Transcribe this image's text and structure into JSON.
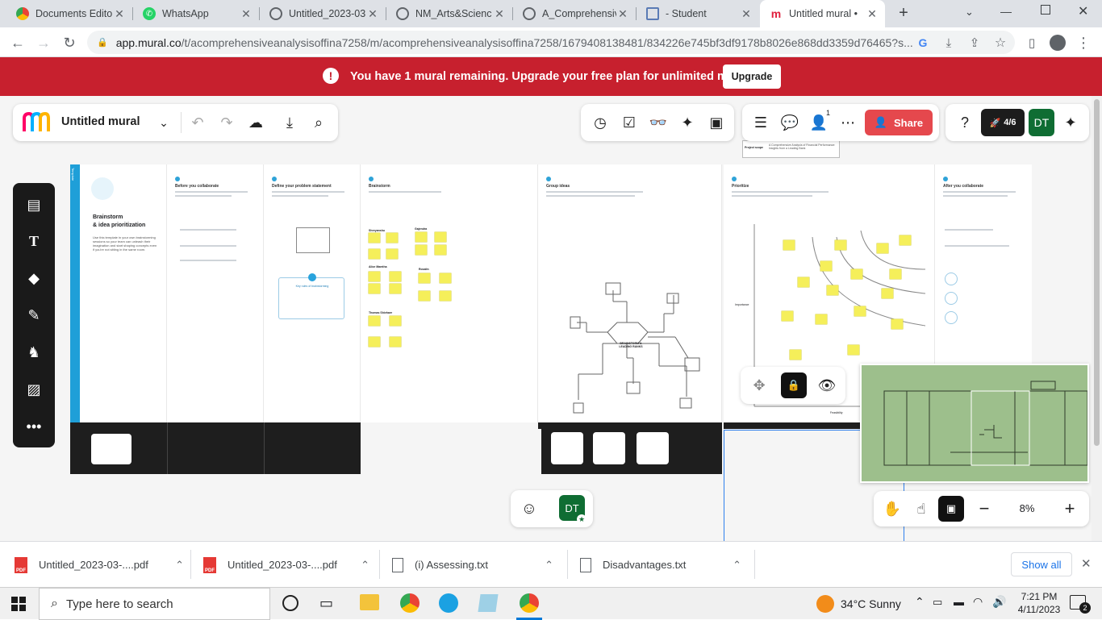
{
  "browser": {
    "tabs": [
      {
        "title": "Documents Edito",
        "favicon": "chrome-icon"
      },
      {
        "title": "WhatsApp",
        "favicon": "whatsapp-icon"
      },
      {
        "title": "Untitled_2023-03",
        "favicon": "globe-icon"
      },
      {
        "title": "NM_Arts&Scienc",
        "favicon": "globe-icon"
      },
      {
        "title": "A_Comprehensiv",
        "favicon": "globe-icon"
      },
      {
        "title": "- Student",
        "favicon": "image-icon"
      },
      {
        "title": "Untitled mural • ",
        "favicon": "mural-icon",
        "active": true
      }
    ],
    "url_host": "app.mural.co",
    "url_path": "/t/acomprehensiveanalysisoffina7258/m/acomprehensiveanalysisoffina7258/1679408138481/834226e745bf3df9178b8026e868dd3359d76465?s..."
  },
  "banner": {
    "message": "You have 1 mural remaining. Upgrade your free plan for unlimited murals.",
    "button": "Upgrade"
  },
  "mural": {
    "title": "Untitled mural",
    "share_label": "Share",
    "progress_label": "4/6",
    "progress_fraction": 0.667,
    "avatar_initials": "DT",
    "collaborator_count": "1",
    "zoom": "8%"
  },
  "board": {
    "template_tag": "Template",
    "main_title_1": "Brainstorm",
    "main_title_2": "& idea prioritization",
    "intro_text": "Use this template in your own brainstorming sessions so your team can unleash their imagination and start shaping concepts even if you're not sitting in the same room.",
    "columns": [
      {
        "title": "Before you collaborate"
      },
      {
        "title": "Define your problem statement"
      },
      {
        "title": "Brainstorm"
      },
      {
        "title": "Group ideas"
      },
      {
        "title": "Prioritize"
      },
      {
        "title": "After you collaborate"
      }
    ],
    "brainstorm_groups": [
      "Shreyanshu",
      "Gajendra",
      "Alice Mamtha",
      "Rosalin",
      "Thomas Shivhare"
    ],
    "group_center": "BRAINSTORM & LEADING RANKS",
    "problem_label": "Key rules of brainstorming",
    "prioritize_axis_y": "Importance",
    "prioritize_axis_x": "Feasibility",
    "top_table_label": "Project scope",
    "top_table_text": "A Comprehensive Analysis of Financial Performance: Insights from a Leading Bank"
  },
  "downloads": {
    "items": [
      {
        "name": "Untitled_2023-03-....pdf",
        "type": "pdf"
      },
      {
        "name": "Untitled_2023-03-....pdf",
        "type": "pdf"
      },
      {
        "name": "(i) Assessing.txt",
        "type": "txt"
      },
      {
        "name": "Disadvantages.txt",
        "type": "txt"
      }
    ],
    "show_all": "Show all"
  },
  "taskbar": {
    "search_placeholder": "Type here to search",
    "weather": "34°C  Sunny",
    "time": "7:21 PM",
    "date": "4/11/2023",
    "notification_count": "2"
  },
  "colors": {
    "banner": "#c7202e",
    "share": "#e5484d",
    "avatar": "#0f6d33",
    "minimap": "#9dbf8c"
  }
}
